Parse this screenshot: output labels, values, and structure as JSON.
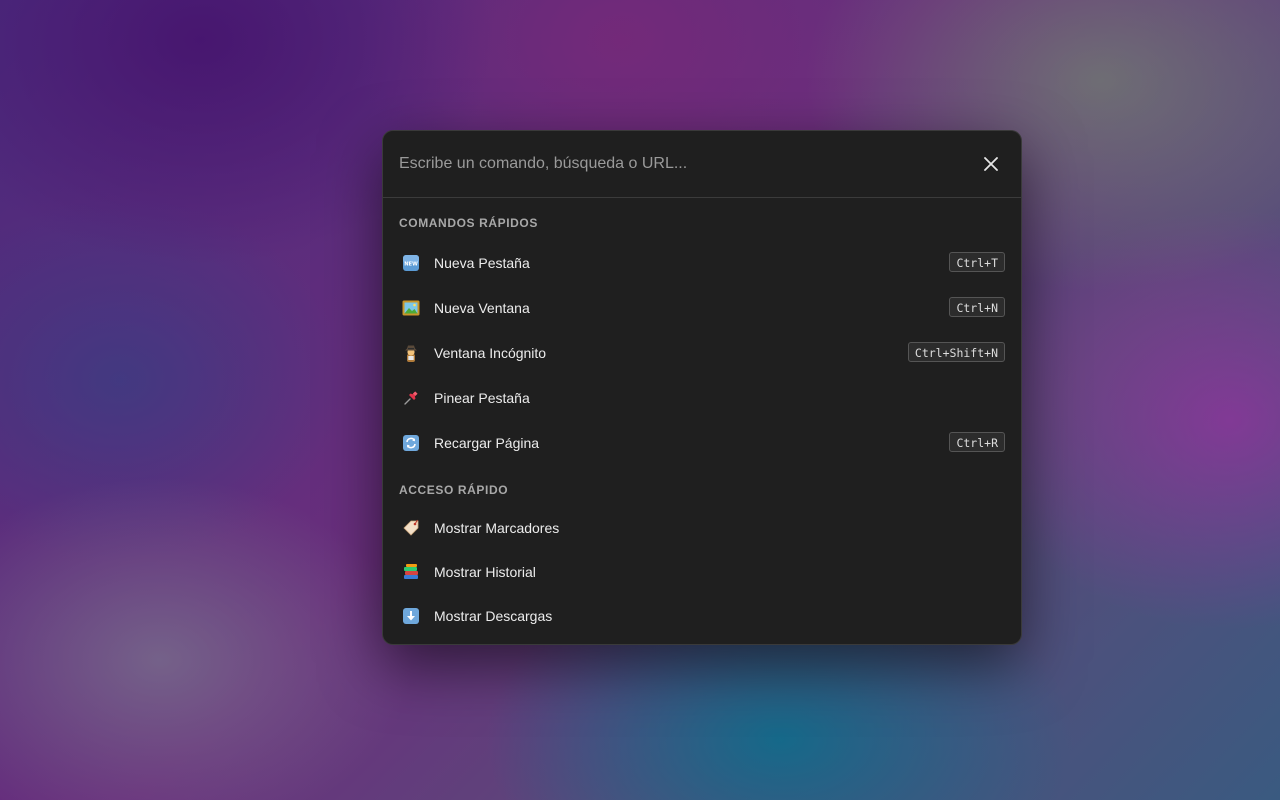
{
  "search": {
    "placeholder": "Escribe un comando, búsqueda o URL...",
    "value": ""
  },
  "sections": [
    {
      "title": "COMANDOS RÁPIDOS",
      "items": [
        {
          "label": "Nueva Pestaña",
          "icon": "new-badge-icon",
          "shortcut": "Ctrl+T"
        },
        {
          "label": "Nueva Ventana",
          "icon": "framed-picture-icon",
          "shortcut": "Ctrl+N"
        },
        {
          "label": "Ventana Incógnito",
          "icon": "detective-icon",
          "shortcut": "Ctrl+Shift+N"
        },
        {
          "label": "Pinear Pestaña",
          "icon": "pushpin-icon",
          "shortcut": ""
        },
        {
          "label": "Recargar Página",
          "icon": "reload-arrows-icon",
          "shortcut": "Ctrl+R"
        }
      ]
    },
    {
      "title": "ACCESO RÁPIDO",
      "items": [
        {
          "label": "Mostrar Marcadores",
          "icon": "bookmark-tag-icon",
          "shortcut": ""
        },
        {
          "label": "Mostrar Historial",
          "icon": "books-stack-icon",
          "shortcut": ""
        },
        {
          "label": "Mostrar Descargas",
          "icon": "down-arrow-icon",
          "shortcut": ""
        }
      ]
    }
  ],
  "colors": {
    "panel_background": "#1f1f1f",
    "text": "#ececec",
    "section_header": "#a8a8a8",
    "placeholder": "#9a9a9a"
  }
}
